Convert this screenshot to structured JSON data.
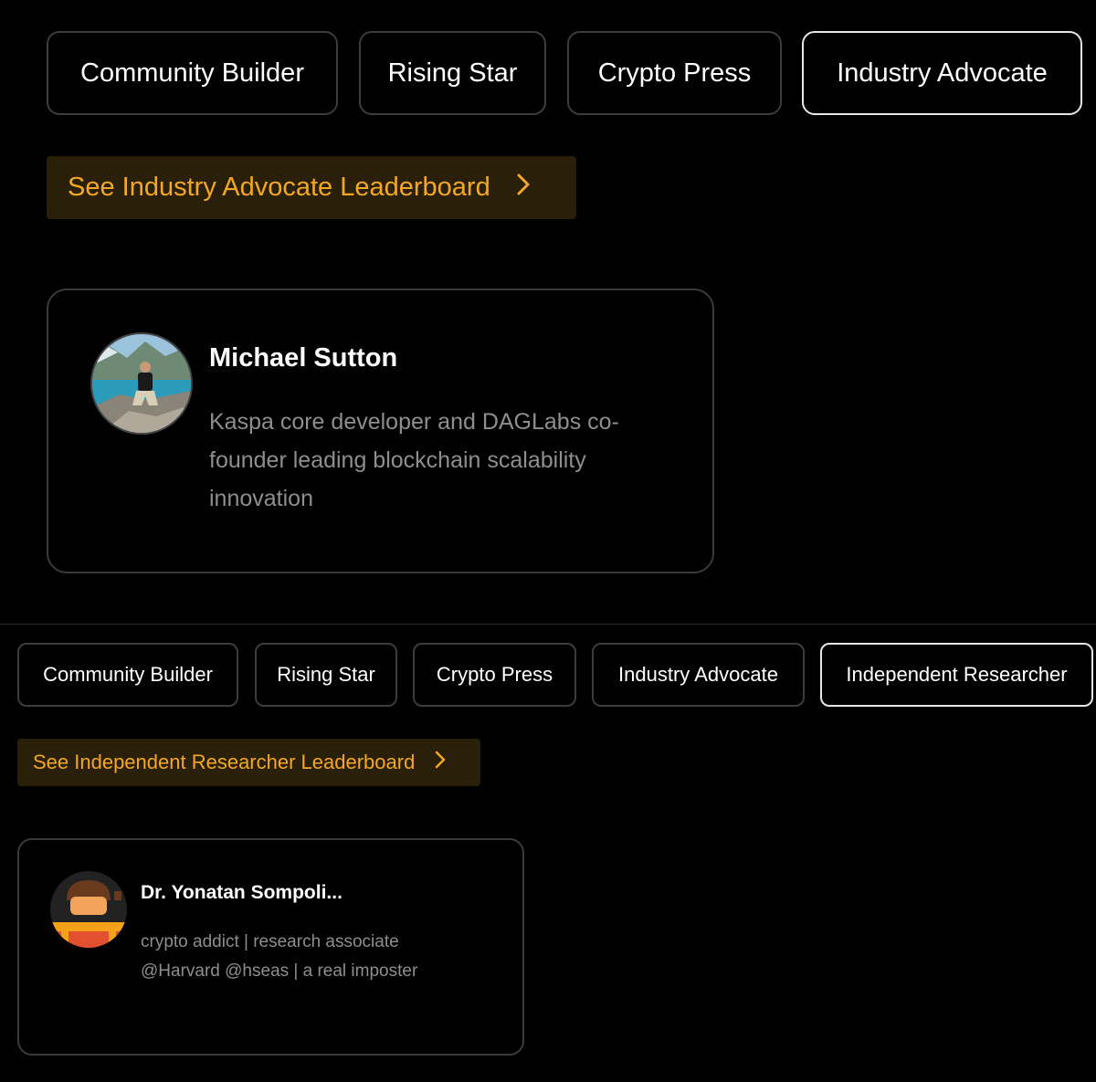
{
  "section1": {
    "tabs": [
      "Community Builder",
      "Rising Star",
      "Crypto Press",
      "Industry Advocate"
    ],
    "active_tab": "Industry Advocate",
    "leaderboard_label": "See Industry Advocate Leaderboard",
    "chevron_icon": "chevron-right-icon",
    "card": {
      "name": "Michael Sutton",
      "bio": "Kaspa core developer and DAGLabs co-founder leading blockchain scalability innovation"
    }
  },
  "section2": {
    "tabs": [
      "Community Builder",
      "Rising Star",
      "Crypto Press",
      "Industry Advocate",
      "Independent Researcher"
    ],
    "active_tab": "Independent Researcher",
    "leaderboard_label": "See Independent Researcher Leaderboard",
    "chevron_icon": "chevron-right-icon",
    "card": {
      "name": "Dr. Yonatan Sompoli...",
      "bio": "crypto addict | research associate @Harvard @hseas | a real imposter"
    }
  },
  "colors": {
    "background": "#000000",
    "accent": "#f2a726",
    "leaderboard_bg": "#2a200a",
    "muted_text": "#8e8e8e",
    "border": "#3c3c3c",
    "active_border": "#e6e6e6"
  }
}
